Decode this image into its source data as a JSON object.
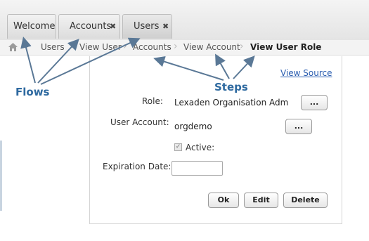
{
  "tabs": [
    {
      "label": "Welcome",
      "closable": false
    },
    {
      "label": "Accounts",
      "closable": true
    },
    {
      "label": "Users",
      "closable": true
    }
  ],
  "close_glyph": "✖",
  "breadcrumb": {
    "home_icon": "home-icon",
    "items": [
      "Users",
      "View User",
      "Accounts",
      "View Account",
      "View User Role"
    ]
  },
  "form": {
    "view_source": "View Source",
    "role_label": "Role:",
    "role_value": "Lexaden Organisation Adm",
    "account_label": "User Account:",
    "account_value": "orgdemo",
    "picker_label": "...",
    "active_label": "Active:",
    "active_checked": true,
    "expiration_label": "Expiration Date:",
    "expiration_value": ""
  },
  "actions": {
    "ok": "Ok",
    "edit": "Edit",
    "delete": "Delete"
  },
  "annotations": {
    "flows": "Flows",
    "steps": "Steps"
  },
  "colors": {
    "annotation": "#2f6aa0",
    "link": "#2a5db0"
  }
}
